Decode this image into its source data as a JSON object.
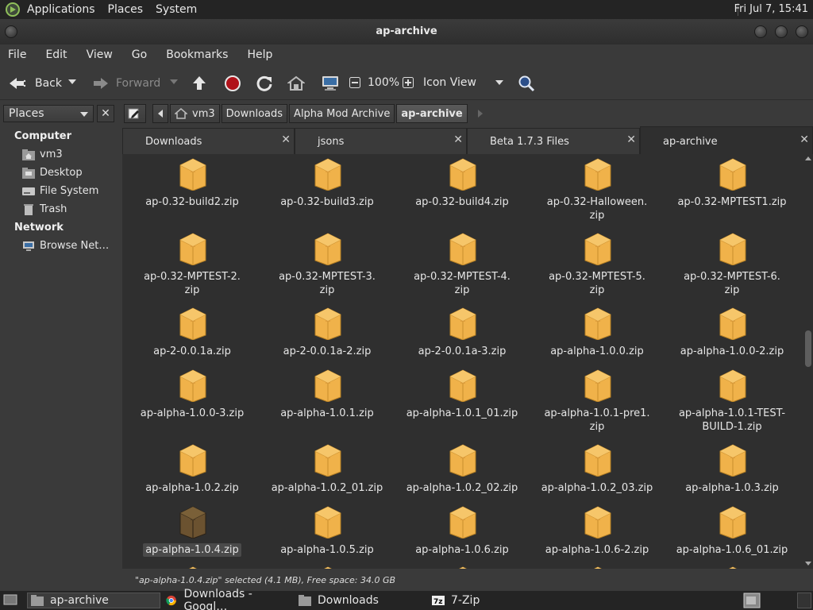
{
  "top_panel": {
    "menus": [
      "Applications",
      "Places",
      "System"
    ],
    "clock": "Fri Jul  7, 15:41"
  },
  "window": {
    "title": "ap-archive"
  },
  "menubar": [
    "File",
    "Edit",
    "View",
    "Go",
    "Bookmarks",
    "Help"
  ],
  "toolbar": {
    "back": "Back",
    "forward": "Forward",
    "zoom": "100%",
    "view_mode": "Icon View"
  },
  "sidebar": {
    "header": "Places",
    "sections": [
      {
        "title": "Computer",
        "items": [
          {
            "label": "vm3",
            "icon": "home-folder-icon"
          },
          {
            "label": "Desktop",
            "icon": "desktop-folder-icon"
          },
          {
            "label": "File System",
            "icon": "drive-icon"
          },
          {
            "label": "Trash",
            "icon": "trash-icon"
          }
        ]
      },
      {
        "title": "Network",
        "items": [
          {
            "label": "Browse Net…",
            "icon": "network-icon"
          }
        ]
      }
    ]
  },
  "pathbar": [
    "vm3",
    "Downloads",
    "Alpha Mod Archive",
    "ap-archive"
  ],
  "tabs": [
    {
      "label": "Downloads",
      "active": false
    },
    {
      "label": "jsons",
      "active": false
    },
    {
      "label": "Beta 1.7.3 Files",
      "active": false
    },
    {
      "label": "ap-archive",
      "active": true
    }
  ],
  "files": [
    [
      "ap-0.32-build2.zip"
    ],
    [
      "ap-0.32-build3.zip"
    ],
    [
      "ap-0.32-build4.zip"
    ],
    [
      "ap-0.32-Halloween.",
      "zip"
    ],
    [
      "ap-0.32-MPTEST1.zip"
    ],
    [
      "ap-0.32-MPTEST-2.",
      "zip"
    ],
    [
      "ap-0.32-MPTEST-3.",
      "zip"
    ],
    [
      "ap-0.32-MPTEST-4.",
      "zip"
    ],
    [
      "ap-0.32-MPTEST-5.",
      "zip"
    ],
    [
      "ap-0.32-MPTEST-6.",
      "zip"
    ],
    [
      "ap-2-0.0.1a.zip"
    ],
    [
      "ap-2-0.0.1a-2.zip"
    ],
    [
      "ap-2-0.0.1a-3.zip"
    ],
    [
      "ap-alpha-1.0.0.zip"
    ],
    [
      "ap-alpha-1.0.0-2.zip"
    ],
    [
      "ap-alpha-1.0.0-3.zip"
    ],
    [
      "ap-alpha-1.0.1.zip"
    ],
    [
      "ap-alpha-1.0.1_01.zip"
    ],
    [
      "ap-alpha-1.0.1-pre1.",
      "zip"
    ],
    [
      "ap-alpha-1.0.1-TEST-",
      "BUILD-1.zip"
    ],
    [
      "ap-alpha-1.0.2.zip"
    ],
    [
      "ap-alpha-1.0.2_01.zip"
    ],
    [
      "ap-alpha-1.0.2_02.zip"
    ],
    [
      "ap-alpha-1.0.2_03.zip"
    ],
    [
      "ap-alpha-1.0.3.zip"
    ],
    [
      "ap-alpha-1.0.4.zip"
    ],
    [
      "ap-alpha-1.0.5.zip"
    ],
    [
      "ap-alpha-1.0.6.zip"
    ],
    [
      "ap-alpha-1.0.6-2.zip"
    ],
    [
      "ap-alpha-1.0.6_01.zip"
    ]
  ],
  "selected_file": "ap-alpha-1.0.4.zip",
  "status": "\"ap-alpha-1.0.4.zip\" selected (4.1 MB), Free space: 34.0 GB",
  "taskbar": [
    {
      "label": "ap-archive",
      "icon": "folder-icon",
      "active": true
    },
    {
      "label": "Downloads - Googl…",
      "icon": "chrome-icon",
      "active": false
    },
    {
      "label": "Downloads",
      "icon": "folder-icon",
      "active": false
    },
    {
      "label": "7-Zip",
      "icon": "7zip-icon",
      "active": false
    }
  ],
  "colors": {
    "zip_icon": "#f0b24a",
    "selected_zip_icon": "#6b5230",
    "window_bg": "#3a3a3a",
    "view_bg": "#2f2f2f"
  }
}
